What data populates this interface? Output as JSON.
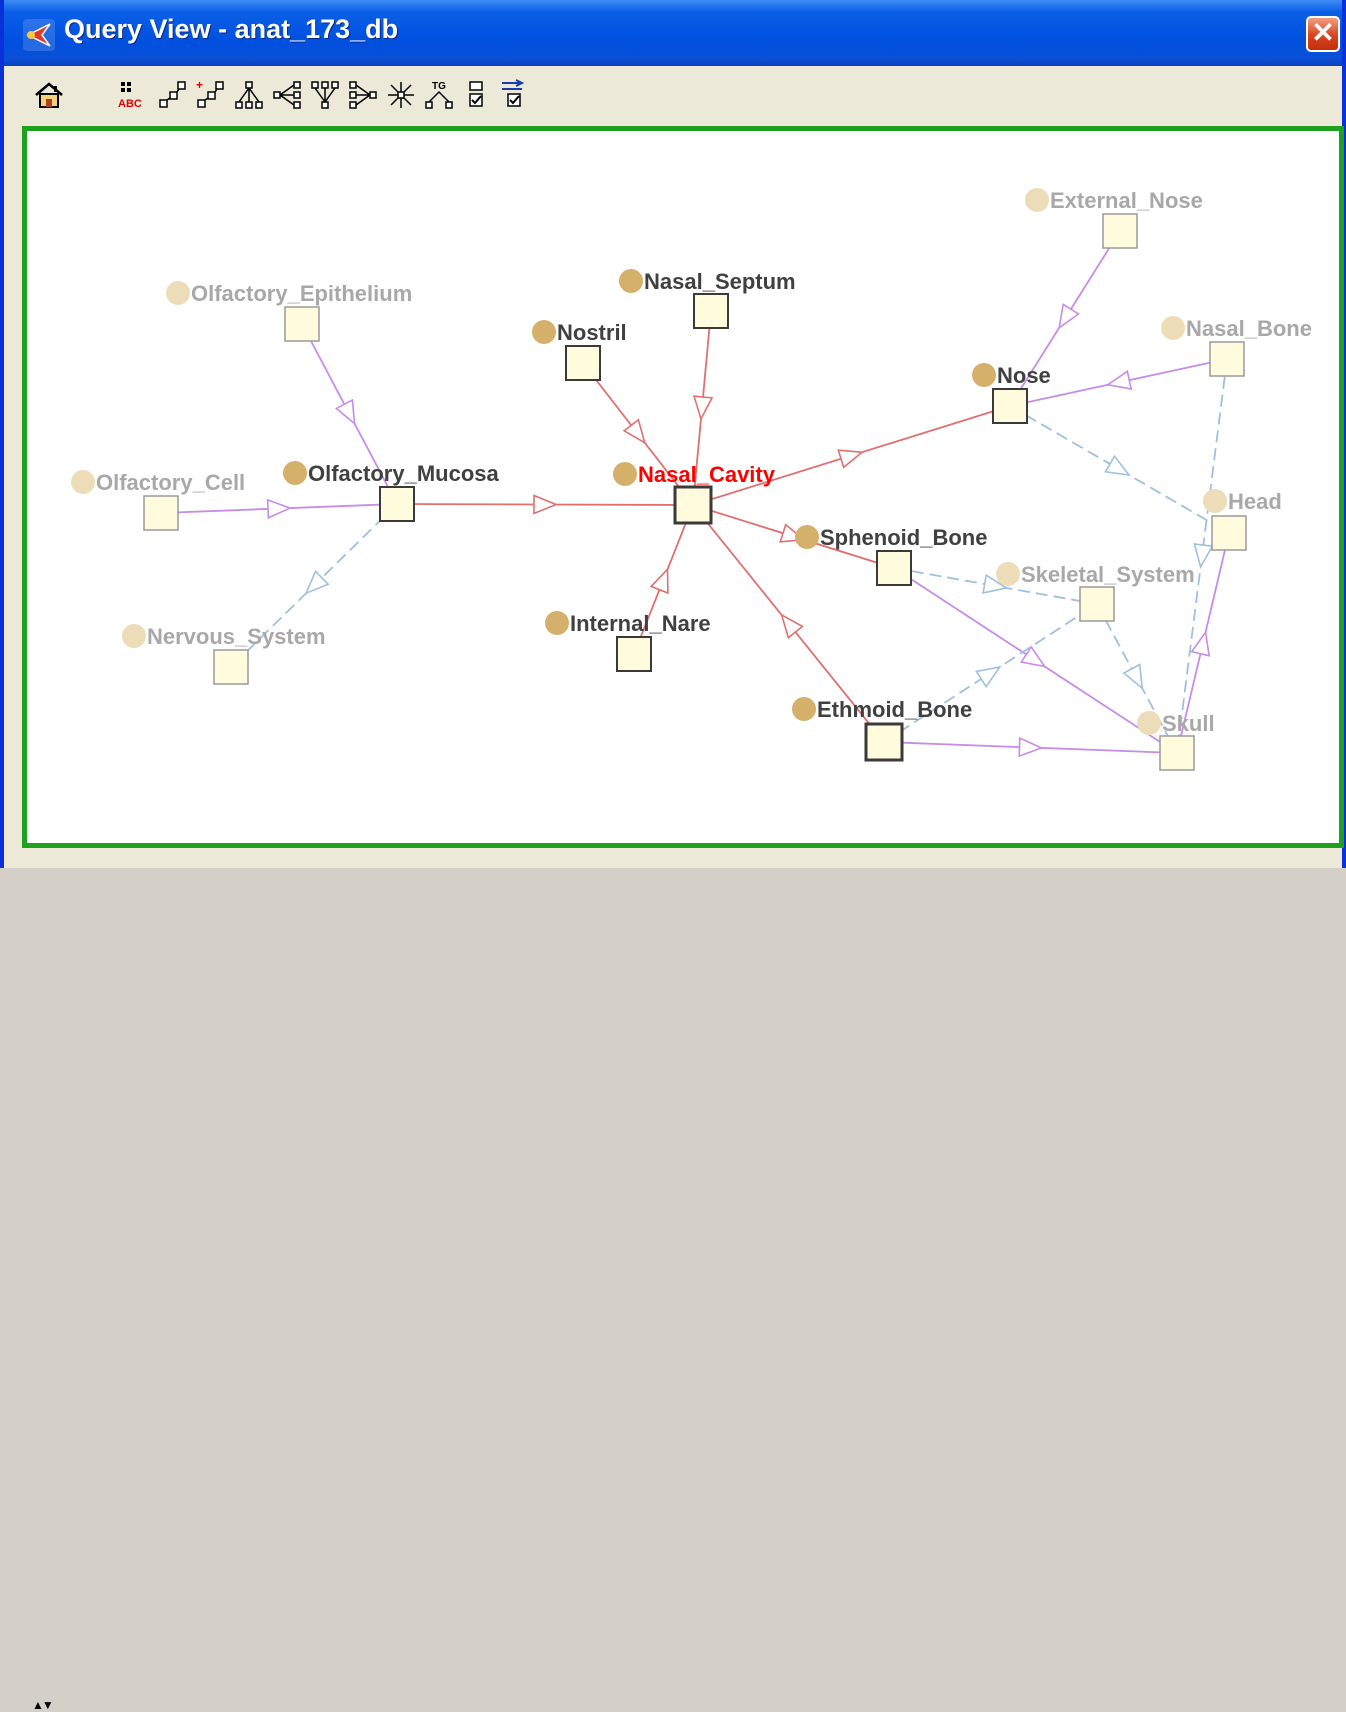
{
  "window": {
    "title": "Query View - anat_173_db",
    "close_label": "✕"
  },
  "toolbar": {
    "buttons": [
      {
        "name": "home-button",
        "icon": "home-icon"
      },
      {
        "name": "label-button",
        "icon": "abc-labels-icon"
      },
      {
        "name": "expand-button",
        "icon": "expand-graph-icon"
      },
      {
        "name": "add-node-button",
        "icon": "add-node-icon"
      },
      {
        "name": "tree-layout-button",
        "icon": "tree-down-icon"
      },
      {
        "name": "tree-left-button",
        "icon": "tree-left-icon"
      },
      {
        "name": "tree-up-button",
        "icon": "tree-up-icon"
      },
      {
        "name": "tree-right-button",
        "icon": "tree-right-icon"
      },
      {
        "name": "radial-layout-button",
        "icon": "radial-layout-icon"
      },
      {
        "name": "tg-layout-button",
        "icon": "tg-layout-icon"
      },
      {
        "name": "checklist-button",
        "icon": "checklist-icon"
      },
      {
        "name": "filter-button",
        "icon": "filter-checklist-icon"
      }
    ],
    "tg_label": "TG",
    "abc_label": "ABC"
  },
  "graph": {
    "colors": {
      "focus_label": "#ff0000",
      "active_label": "#404040",
      "faded_label": "#a8a8a8",
      "active_dot": "#d4b06a",
      "faded_dot": "#eddcb8",
      "node_fill": "#fffbdc",
      "red_edge": "#e07070",
      "purple_edge": "#c88ce8",
      "blue_edge": "#9ec0e0"
    },
    "nodes": [
      {
        "id": "nasal_cavity",
        "label": "Nasal_Cavity",
        "style": "focus"
      },
      {
        "id": "nasal_septum",
        "label": "Nasal_Septum",
        "style": "active"
      },
      {
        "id": "nostril",
        "label": "Nostril",
        "style": "active"
      },
      {
        "id": "internal_nare",
        "label": "Internal_Nare",
        "style": "active"
      },
      {
        "id": "olfactory_mucosa",
        "label": "Olfactory_Mucosa",
        "style": "active"
      },
      {
        "id": "nose",
        "label": "Nose",
        "style": "active"
      },
      {
        "id": "sphenoid_bone",
        "label": "Sphenoid_Bone",
        "style": "active"
      },
      {
        "id": "ethmoid_bone",
        "label": "Ethmoid_Bone",
        "style": "active"
      },
      {
        "id": "olfactory_epithelium",
        "label": "Olfactory_Epithelium",
        "style": "faded"
      },
      {
        "id": "olfactory_cell",
        "label": "Olfactory_Cell",
        "style": "faded"
      },
      {
        "id": "nervous_system",
        "label": "Nervous_System",
        "style": "faded"
      },
      {
        "id": "external_nose",
        "label": "External_Nose",
        "style": "faded"
      },
      {
        "id": "nasal_bone",
        "label": "Nasal_Bone",
        "style": "faded"
      },
      {
        "id": "head",
        "label": "Head",
        "style": "faded"
      },
      {
        "id": "skeletal_system",
        "label": "Skeletal_System",
        "style": "faded"
      },
      {
        "id": "skull",
        "label": "Skull",
        "style": "faded"
      }
    ],
    "edges": [
      {
        "from": "nasal_septum",
        "to": "nasal_cavity",
        "kind": "red"
      },
      {
        "from": "nostril",
        "to": "nasal_cavity",
        "kind": "red"
      },
      {
        "from": "internal_nare",
        "to": "nasal_cavity",
        "kind": "red"
      },
      {
        "from": "olfactory_mucosa",
        "to": "nasal_cavity",
        "kind": "red"
      },
      {
        "from": "nasal_cavity",
        "to": "nose",
        "kind": "red"
      },
      {
        "from": "nasal_cavity",
        "to": "sphenoid_bone",
        "kind": "red"
      },
      {
        "from": "ethmoid_bone",
        "to": "nasal_cavity",
        "kind": "red"
      },
      {
        "from": "olfactory_epithelium",
        "to": "olfactory_mucosa",
        "kind": "purple"
      },
      {
        "from": "olfactory_cell",
        "to": "olfactory_mucosa",
        "kind": "purple"
      },
      {
        "from": "olfactory_mucosa",
        "to": "nervous_system",
        "kind": "blue"
      },
      {
        "from": "external_nose",
        "to": "nose",
        "kind": "purple"
      },
      {
        "from": "nasal_bone",
        "to": "nose",
        "kind": "purple"
      },
      {
        "from": "nose",
        "to": "head",
        "kind": "blue"
      },
      {
        "from": "nasal_bone",
        "to": "skull",
        "kind": "blue"
      },
      {
        "from": "sphenoid_bone",
        "to": "skeletal_system",
        "kind": "blue"
      },
      {
        "from": "sphenoid_bone",
        "to": "skull",
        "kind": "purple"
      },
      {
        "from": "ethmoid_bone",
        "to": "skeletal_system",
        "kind": "blue"
      },
      {
        "from": "ethmoid_bone",
        "to": "skull",
        "kind": "purple"
      },
      {
        "from": "skeletal_system",
        "to": "skull",
        "kind": "blue"
      },
      {
        "from": "skull",
        "to": "head",
        "kind": "purple"
      }
    ]
  }
}
